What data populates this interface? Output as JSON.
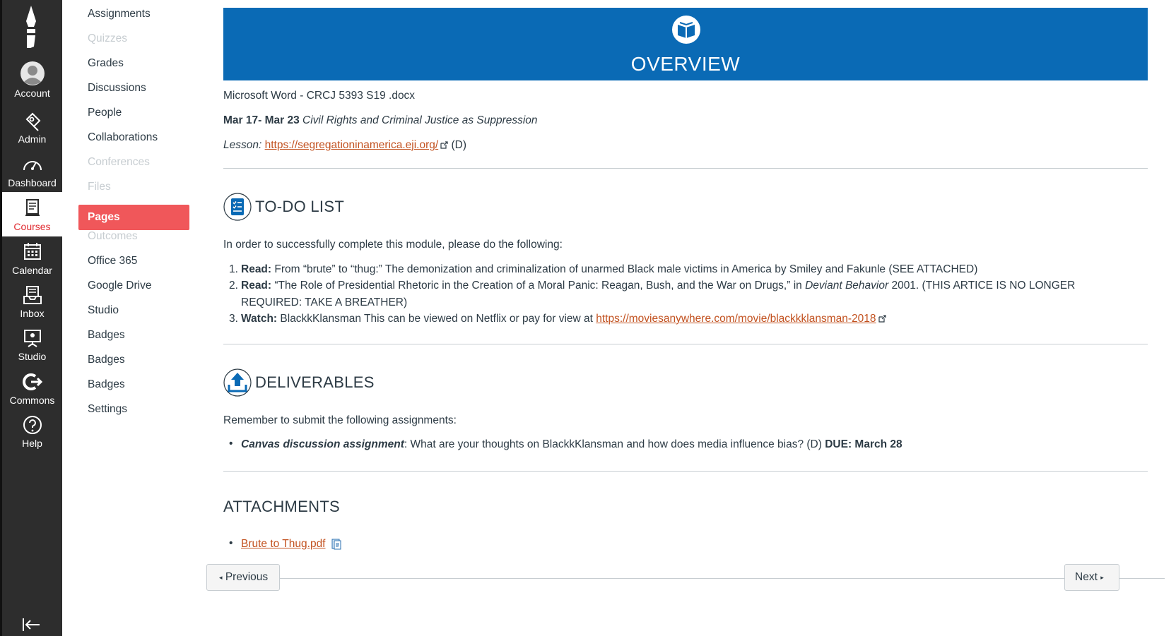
{
  "global_nav": {
    "items": [
      {
        "label": "Account",
        "icon": "account-icon"
      },
      {
        "label": "Admin",
        "icon": "admin-icon"
      },
      {
        "label": "Dashboard",
        "icon": "dashboard-icon"
      },
      {
        "label": "Courses",
        "icon": "courses-icon"
      },
      {
        "label": "Calendar",
        "icon": "calendar-icon"
      },
      {
        "label": "Inbox",
        "icon": "inbox-icon"
      },
      {
        "label": "Studio",
        "icon": "studio-icon"
      },
      {
        "label": "Commons",
        "icon": "commons-icon"
      },
      {
        "label": "Help",
        "icon": "help-icon"
      }
    ],
    "active": "Courses",
    "active_color": "#e0292f"
  },
  "course_nav": {
    "items": [
      {
        "label": "Assignments",
        "disabled": false
      },
      {
        "label": "Quizzes",
        "disabled": true
      },
      {
        "label": "Grades",
        "disabled": false
      },
      {
        "label": "Discussions",
        "disabled": false
      },
      {
        "label": "People",
        "disabled": false
      },
      {
        "label": "Collaborations",
        "disabled": false
      },
      {
        "label": "Conferences",
        "disabled": true
      },
      {
        "label": "Files",
        "disabled": true
      },
      {
        "label": "Pages",
        "disabled": false,
        "active": true
      },
      {
        "label": "Outcomes",
        "disabled": true
      },
      {
        "label": "Office 365",
        "disabled": false
      },
      {
        "label": "Google Drive",
        "disabled": false
      },
      {
        "label": "Studio",
        "disabled": false
      },
      {
        "label": "Badges",
        "disabled": false
      },
      {
        "label": "Badges",
        "disabled": false
      },
      {
        "label": "Badges",
        "disabled": false
      },
      {
        "label": "Settings",
        "disabled": false
      }
    ],
    "active_color": "#f0575a"
  },
  "content": {
    "banner_title": "OVERVIEW",
    "banner_color": "#0a6ab5",
    "doc_title": "Microsoft Word - CRCJ 5393 S19 .docx",
    "dates_bold": "Mar 17- Mar 23",
    "dates_italic": "Civil Rights and Criminal Justice as Suppression",
    "lesson_label": "Lesson:",
    "lesson_link": "https://segregationinamerica.eji.org/",
    "lesson_suffix": "(D)",
    "todo_title": "TO-DO LIST",
    "todo_intro": "In order to successfully complete this module, please do the following:",
    "todo_items": [
      {
        "num": "1.",
        "label": "Read:",
        "text": "From “brute” to “thug:” The demonization and criminalization of unarmed Black male victims in America by Smiley and Fakunle (SEE ATTACHED)"
      },
      {
        "num": "2.",
        "label": "Read:",
        "text_a": "“The Role of Presidential Rhetoric in the Creation of a Moral Panic: Reagan, Bush, and the War on Drugs,” in ",
        "text_italic": "Deviant Behavior",
        "text_b": " 2001. (THIS ARTICE IS NO LONGER REQUIRED: TAKE A BREATHER)"
      },
      {
        "num": "3.",
        "label": "Watch:",
        "text": "BlackkKlansman This can be viewed on Netflix or pay for view at ",
        "link": "https://moviesanywhere.com/movie/blackkklansman-2018"
      }
    ],
    "deliverables_title": "DELIVERABLES",
    "deliverables_intro": "Remember to submit the following assignments:",
    "deliverable": {
      "label": "Canvas discussion assignment",
      "text": ": What are your thoughts on BlackkKlansman and how does media influence bias? (D) ",
      "due": "DUE: March 28"
    },
    "attachments_title": "ATTACHMENTS",
    "attachment_link": "Brute to Thug.pdf",
    "link_color": "#c2511f"
  },
  "footer": {
    "previous_label": "Previous",
    "next_label": "Next"
  }
}
